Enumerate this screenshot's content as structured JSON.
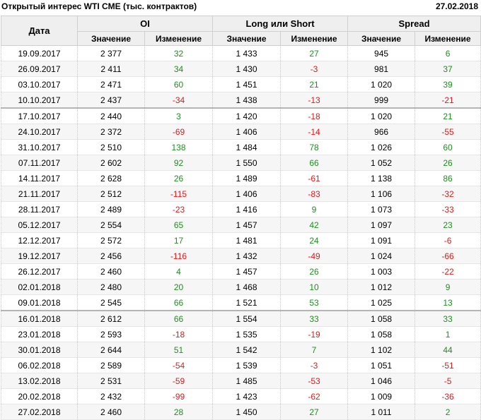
{
  "header": {
    "title": "Открытый интерес WTI CME (тыс. контрактов)",
    "date": "27.02.2018"
  },
  "columns": {
    "date": "Дата",
    "groups": [
      "OI",
      "Long или Short",
      "Spread"
    ],
    "value": "Значение",
    "change": "Изменение"
  },
  "colors": {
    "positive": "#1f8f1f",
    "negative": "#d42020"
  },
  "rows": [
    {
      "date": "19.09.2017",
      "oi": "2 377",
      "oi_chg": "32",
      "ls": "1 433",
      "ls_chg": "27",
      "sp": "945",
      "sp_chg": "6"
    },
    {
      "date": "26.09.2017",
      "oi": "2 411",
      "oi_chg": "34",
      "ls": "1 430",
      "ls_chg": "-3",
      "sp": "981",
      "sp_chg": "37"
    },
    {
      "date": "03.10.2017",
      "oi": "2 471",
      "oi_chg": "60",
      "ls": "1 451",
      "ls_chg": "21",
      "sp": "1 020",
      "sp_chg": "39"
    },
    {
      "date": "10.10.2017",
      "oi": "2 437",
      "oi_chg": "-34",
      "ls": "1 438",
      "ls_chg": "-13",
      "sp": "999",
      "sp_chg": "-21"
    },
    {
      "date": "17.10.2017",
      "oi": "2 440",
      "oi_chg": "3",
      "ls": "1 420",
      "ls_chg": "-18",
      "sp": "1 020",
      "sp_chg": "21"
    },
    {
      "date": "24.10.2017",
      "oi": "2 372",
      "oi_chg": "-69",
      "ls": "1 406",
      "ls_chg": "-14",
      "sp": "966",
      "sp_chg": "-55"
    },
    {
      "date": "31.10.2017",
      "oi": "2 510",
      "oi_chg": "138",
      "ls": "1 484",
      "ls_chg": "78",
      "sp": "1 026",
      "sp_chg": "60"
    },
    {
      "date": "07.11.2017",
      "oi": "2 602",
      "oi_chg": "92",
      "ls": "1 550",
      "ls_chg": "66",
      "sp": "1 052",
      "sp_chg": "26"
    },
    {
      "date": "14.11.2017",
      "oi": "2 628",
      "oi_chg": "26",
      "ls": "1 489",
      "ls_chg": "-61",
      "sp": "1 138",
      "sp_chg": "86"
    },
    {
      "date": "21.11.2017",
      "oi": "2 512",
      "oi_chg": "-115",
      "ls": "1 406",
      "ls_chg": "-83",
      "sp": "1 106",
      "sp_chg": "-32"
    },
    {
      "date": "28.11.2017",
      "oi": "2 489",
      "oi_chg": "-23",
      "ls": "1 416",
      "ls_chg": "9",
      "sp": "1 073",
      "sp_chg": "-33"
    },
    {
      "date": "05.12.2017",
      "oi": "2 554",
      "oi_chg": "65",
      "ls": "1 457",
      "ls_chg": "42",
      "sp": "1 097",
      "sp_chg": "23"
    },
    {
      "date": "12.12.2017",
      "oi": "2 572",
      "oi_chg": "17",
      "ls": "1 481",
      "ls_chg": "24",
      "sp": "1 091",
      "sp_chg": "-6"
    },
    {
      "date": "19.12.2017",
      "oi": "2 456",
      "oi_chg": "-116",
      "ls": "1 432",
      "ls_chg": "-49",
      "sp": "1 024",
      "sp_chg": "-66"
    },
    {
      "date": "26.12.2017",
      "oi": "2 460",
      "oi_chg": "4",
      "ls": "1 457",
      "ls_chg": "26",
      "sp": "1 003",
      "sp_chg": "-22"
    },
    {
      "date": "02.01.2018",
      "oi": "2 480",
      "oi_chg": "20",
      "ls": "1 468",
      "ls_chg": "10",
      "sp": "1 012",
      "sp_chg": "9"
    },
    {
      "date": "09.01.2018",
      "oi": "2 545",
      "oi_chg": "66",
      "ls": "1 521",
      "ls_chg": "53",
      "sp": "1 025",
      "sp_chg": "13"
    },
    {
      "date": "16.01.2018",
      "oi": "2 612",
      "oi_chg": "66",
      "ls": "1 554",
      "ls_chg": "33",
      "sp": "1 058",
      "sp_chg": "33"
    },
    {
      "date": "23.01.2018",
      "oi": "2 593",
      "oi_chg": "-18",
      "ls": "1 535",
      "ls_chg": "-19",
      "sp": "1 058",
      "sp_chg": "1"
    },
    {
      "date": "30.01.2018",
      "oi": "2 644",
      "oi_chg": "51",
      "ls": "1 542",
      "ls_chg": "7",
      "sp": "1 102",
      "sp_chg": "44"
    },
    {
      "date": "06.02.2018",
      "oi": "2 589",
      "oi_chg": "-54",
      "ls": "1 539",
      "ls_chg": "-3",
      "sp": "1 051",
      "sp_chg": "-51"
    },
    {
      "date": "13.02.2018",
      "oi": "2 531",
      "oi_chg": "-59",
      "ls": "1 485",
      "ls_chg": "-53",
      "sp": "1 046",
      "sp_chg": "-5"
    },
    {
      "date": "20.02.2018",
      "oi": "2 432",
      "oi_chg": "-99",
      "ls": "1 423",
      "ls_chg": "-62",
      "sp": "1 009",
      "sp_chg": "-36"
    },
    {
      "date": "27.02.2018",
      "oi": "2 460",
      "oi_chg": "28",
      "ls": "1 450",
      "ls_chg": "27",
      "sp": "1 011",
      "sp_chg": "2"
    }
  ]
}
